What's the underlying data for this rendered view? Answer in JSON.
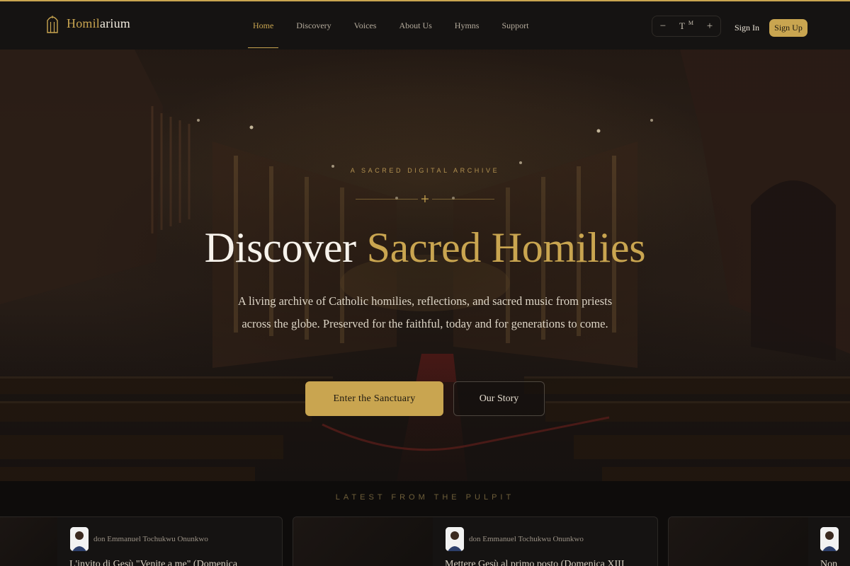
{
  "brand": {
    "name_part1": "Homil",
    "name_part2": "arium"
  },
  "nav": {
    "items": [
      {
        "label": "Home",
        "active": true
      },
      {
        "label": "Discovery",
        "active": false
      },
      {
        "label": "Voices",
        "active": false
      },
      {
        "label": "About Us",
        "active": false
      },
      {
        "label": "Hymns",
        "active": false
      },
      {
        "label": "Support",
        "active": false
      }
    ]
  },
  "font_control": {
    "decrease": "−",
    "glyph": "T",
    "size": "M",
    "increase": "+"
  },
  "auth": {
    "sign_in": "Sign In",
    "sign_up": "Sign Up"
  },
  "hero": {
    "eyebrow": "A SACRED DIGITAL ARCHIVE",
    "title_white": "Discover ",
    "title_gold": "Sacred Homilies",
    "lede": "A living archive of Catholic homilies, reflections, and sacred music from priests across the globe. Preserved for the faithful, today and for generations to come.",
    "primary_cta": "Enter the Sanctuary",
    "secondary_cta": "Our Story"
  },
  "latest": {
    "heading": "LATEST FROM THE PULPIT",
    "cards": [
      {
        "author": "don Emmanuel Tochukwu Onunkwo",
        "title": "L'invito di Gesù \"Venite a me\" (Domenica"
      },
      {
        "author": "don Emmanuel Tochukwu Onunkwo",
        "title": "Mettere Gesù al primo posto (Domenica XIII"
      },
      {
        "author": "",
        "title": "Non"
      }
    ]
  },
  "colors": {
    "accent": "#c9a550",
    "background": "#0f0d0b",
    "header": "#151312"
  }
}
